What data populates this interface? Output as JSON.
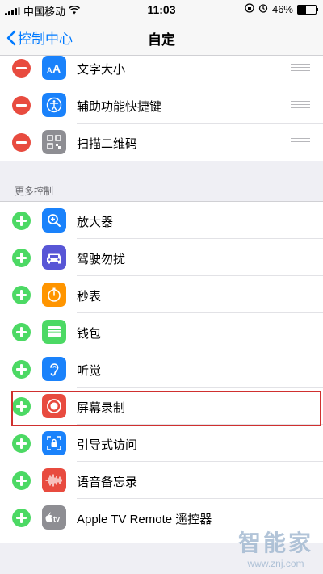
{
  "status_bar": {
    "carrier": "中国移动",
    "time": "11:03",
    "battery": "46%",
    "battery_level": 0.46
  },
  "nav": {
    "back_label": "控制中心",
    "title": "自定"
  },
  "included": [
    {
      "label": "文字大小",
      "icon": "text-size-icon",
      "icon_color": "#1a82fb"
    },
    {
      "label": "辅助功能快捷键",
      "icon": "accessibility-icon",
      "icon_color": "#1a82fb"
    },
    {
      "label": "扫描二维码",
      "icon": "qr-code-icon",
      "icon_color": "#8e8e93"
    }
  ],
  "more_controls": {
    "header": "更多控制",
    "items": [
      {
        "label": "放大器",
        "icon": "magnifier-icon",
        "icon_color": "#1a82fb"
      },
      {
        "label": "驾驶勿扰",
        "icon": "car-icon",
        "icon_color": "#5856d6"
      },
      {
        "label": "秒表",
        "icon": "stopwatch-icon",
        "icon_color": "#ff9500"
      },
      {
        "label": "钱包",
        "icon": "wallet-icon",
        "icon_color": "#4cd964"
      },
      {
        "label": "听觉",
        "icon": "ear-icon",
        "icon_color": "#1a82fb"
      },
      {
        "label": "屏幕录制",
        "icon": "screen-record-icon",
        "icon_color": "#e84b3f"
      },
      {
        "label": "引导式访问",
        "icon": "guided-access-icon",
        "icon_color": "#1a82fb"
      },
      {
        "label": "语音备忘录",
        "icon": "voice-memo-icon",
        "icon_color": "#e84b3f"
      },
      {
        "label": "Apple TV Remote 遥控器",
        "icon": "apple-tv-icon",
        "icon_color": "#8e8e93"
      }
    ]
  },
  "watermark": {
    "brand": "智能家",
    "url": "www.znj.com"
  },
  "colors": {
    "accent": "#007aff",
    "remove": "#e84b3f",
    "add": "#4cd964",
    "highlight": "#d0302f"
  }
}
